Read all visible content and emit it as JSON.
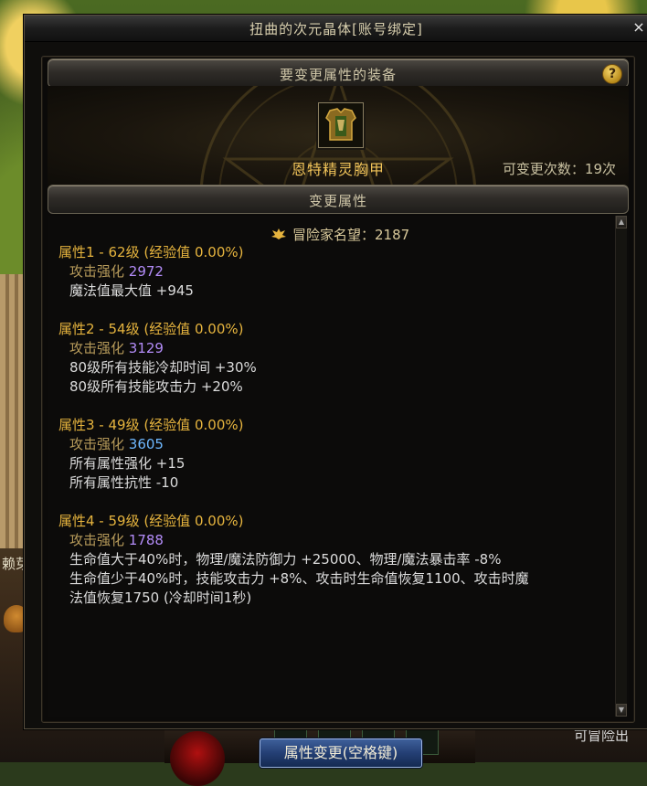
{
  "window": {
    "title": "扭曲的次元晶体[账号绑定]",
    "close_label": "×"
  },
  "equip_section": {
    "header": "要变更属性的装备",
    "help_label": "?",
    "item_name": "恩特精灵胸甲",
    "change_count": "可变更次数：19次"
  },
  "attr_section": {
    "header": "变更属性",
    "fame": "冒险家名望：2187",
    "attributes": [
      {
        "head": "属性1 - 62级 (经验值 0.00%)",
        "atk_label": "攻击强化",
        "atk_value": "2972",
        "lines": [
          "魔法值最大值 +945"
        ]
      },
      {
        "head": "属性2 - 54级 (经验值 0.00%)",
        "atk_label": "攻击强化",
        "atk_value": "3129",
        "lines": [
          "80级所有技能冷却时间 +30%",
          "80级所有技能攻击力 +20%"
        ]
      },
      {
        "head": "属性3 - 49级 (经验值 0.00%)",
        "atk_label": "攻击强化",
        "atk_value": "3605",
        "lines": [
          "所有属性强化 +15",
          "所有属性抗性 -10"
        ]
      },
      {
        "head": "属性4 - 59级 (经验值 0.00%)",
        "atk_label": "攻击强化",
        "atk_value": "1788",
        "lines": [
          "生命值大于40%时，物理/魔法防御力 +25000、物理/魔法暴击率 -8%",
          "生命值少于40%时，技能攻击力 +8%、攻击时生命值恢复1100、攻击时魔",
          "法值恢复1750 (冷却时间1秒)"
        ]
      }
    ]
  },
  "action_button": "属性变更(空格键)",
  "background": {
    "left_text": "赖芽",
    "right_text": "可冒险出"
  },
  "colors": {
    "gold": "#e6b43e",
    "item_name": "#f2c55a",
    "purple_value": "#b38cf8",
    "blue_value": "#6fb8ff"
  }
}
